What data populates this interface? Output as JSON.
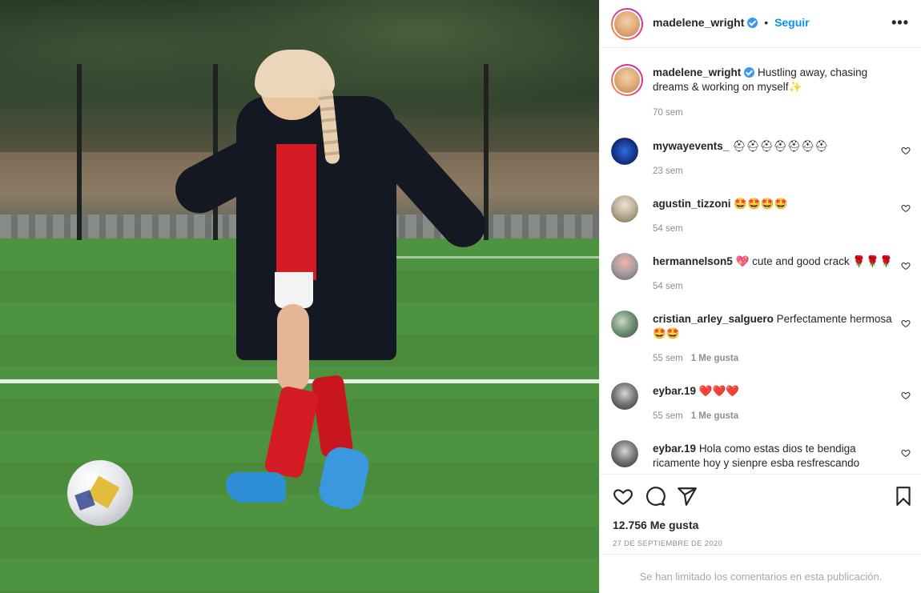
{
  "post": {
    "username": "madelene_wright",
    "follow_label": "Seguir",
    "dot": "•",
    "more_label": "•••",
    "caption_text": "Hustling away, chasing dreams & working on myself✨",
    "caption_time": "70 sem",
    "likes": "12.756 Me gusta",
    "date": "27 DE SEPTIEMBRE DE 2020",
    "comments_limited": "Se han limitado los comentarios en esta publicación."
  },
  "comments": [
    {
      "username": "mywayevents_",
      "text": "⛑⛑⛑⛑⛑⛑⛑",
      "time": "23 sem",
      "likes": ""
    },
    {
      "username": "agustin_tizzoni",
      "text": "🤩🤩🤩🤩",
      "time": "54 sem",
      "likes": ""
    },
    {
      "username": "hermannelson5",
      "text": "💖 cute and good crack 🌹🌹🌹",
      "time": "54 sem",
      "likes": ""
    },
    {
      "username": "cristian_arley_salguero",
      "text": "Perfectamente hermosa 🤩🤩",
      "time": "55 sem",
      "likes": "1 Me gusta"
    },
    {
      "username": "eybar.19",
      "text": "❤️❤️❤️",
      "time": "55 sem",
      "likes": "1 Me gusta"
    },
    {
      "username": "eybar.19",
      "text": "Hola como estas dios te bendiga ricamente hoy y sienpre esba resfrescando",
      "time": "",
      "likes": ""
    }
  ],
  "icons": {
    "verified": "verified-badge-icon",
    "like": "heart-icon",
    "comment": "comment-icon",
    "share": "paper-plane-icon",
    "save": "bookmark-icon"
  },
  "colors": {
    "accent": "#0095f6",
    "verified": "#3897f0",
    "muted": "#8e8e8e"
  }
}
